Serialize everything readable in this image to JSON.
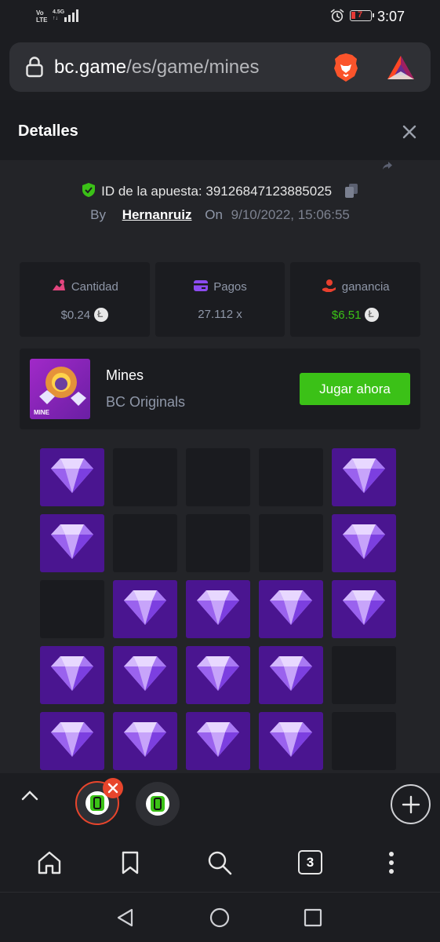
{
  "status_bar": {
    "network_top": "Vo",
    "network_bottom": "LTE",
    "network_type": "4.5G",
    "network_arrows": "↑↓",
    "battery_level": "7",
    "time": "3:07",
    "icons": [
      "signal-icon",
      "alarm-icon",
      "battery-icon"
    ]
  },
  "browser": {
    "url_host": "bc.game",
    "url_path": "/es/game/mines",
    "icons": [
      "lock-icon",
      "brave-lion-icon",
      "bat-rewards-icon"
    ]
  },
  "details": {
    "title": "Detalles",
    "bet_id_label": "ID de la apuesta:",
    "bet_id": "39126847123885025",
    "by_label": "By",
    "username": "Hernanruiz",
    "on_label": "On",
    "datetime": "9/10/2022, 15:06:55"
  },
  "stats": [
    {
      "label": "Cantidad",
      "value": "$0.24",
      "icon": "bet-amount-icon",
      "color": "#e2457e"
    },
    {
      "label": "Pagos",
      "value": "27.112 x",
      "icon": "payout-card-icon",
      "color": "#8c4bf0"
    },
    {
      "label": "ganancia",
      "value": "$6.51",
      "icon": "profit-hand-icon",
      "color": "#e8402e"
    }
  ],
  "game": {
    "name": "Mines",
    "provider": "BC Originals",
    "thumb_tag": "MINE",
    "play_label": "Jugar ahora"
  },
  "board": {
    "rows": 5,
    "cols": 5,
    "cells": [
      "gem",
      "empty",
      "empty",
      "empty",
      "gem",
      "gem",
      "empty",
      "empty",
      "empty",
      "gem",
      "empty",
      "gem",
      "gem",
      "gem",
      "gem",
      "gem",
      "gem",
      "gem",
      "gem",
      "empty",
      "gem",
      "gem",
      "gem",
      "gem",
      "empty"
    ]
  },
  "tab_strip": {
    "open_tabs": 2,
    "active_tab_color": "#e8452c"
  },
  "toolbar": {
    "tab_count": "3",
    "icons": [
      "home-icon",
      "bookmark-icon",
      "search-icon",
      "tabs-icon",
      "more-icon"
    ]
  },
  "colors": {
    "accent_green": "#3bc117",
    "gem_tile": "#4a1590",
    "empty_tile": "#1a1b1f",
    "panel": "#1b1c20"
  }
}
